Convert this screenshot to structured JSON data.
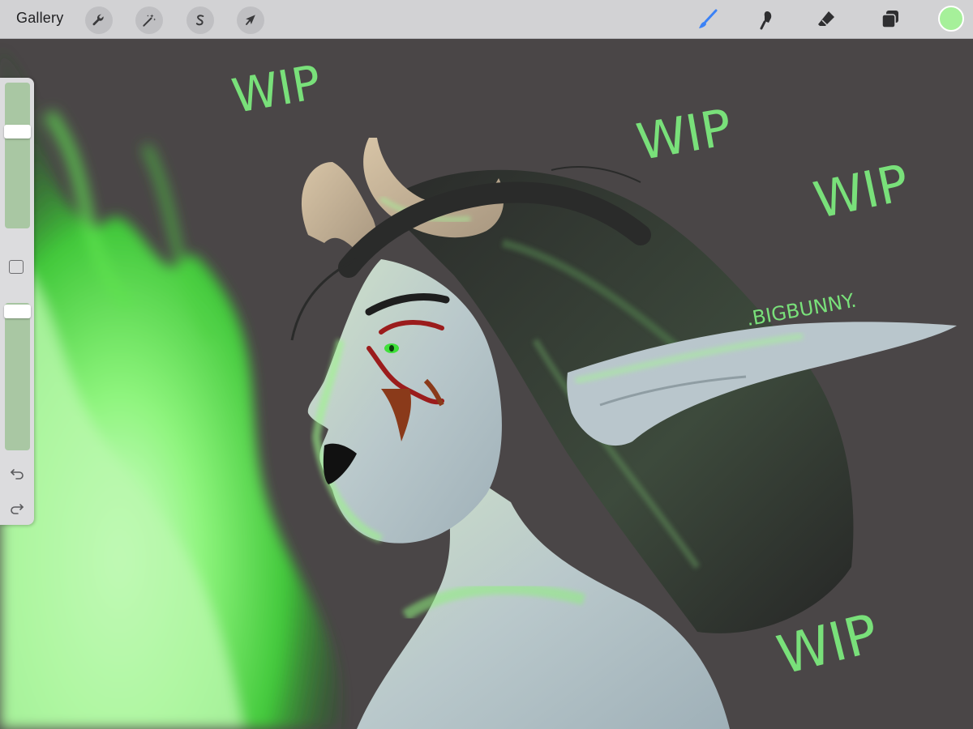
{
  "toolbar": {
    "gallery_label": "Gallery",
    "left_tools": [
      {
        "name": "actions-wrench-icon"
      },
      {
        "name": "adjustments-magic-wand-icon"
      },
      {
        "name": "selection-s-icon"
      },
      {
        "name": "transform-arrow-icon"
      }
    ],
    "right_tools": [
      {
        "name": "brush-icon",
        "active": true
      },
      {
        "name": "smudge-icon"
      },
      {
        "name": "eraser-icon"
      },
      {
        "name": "layers-icon"
      }
    ],
    "current_color": "#a6f09a",
    "active_color": "#3b82f6"
  },
  "sidebar": {
    "brush_size_level": 0.78,
    "opacity_level": 0.96,
    "modify_button": "square-icon",
    "undo_icon": "undo-icon",
    "redo_icon": "redo-icon"
  },
  "canvas": {
    "background_color": "#4a4647",
    "handwritten_notes": [
      "WIP",
      "WIP",
      "WIP",
      "WIP",
      ".BIGBUNNY."
    ],
    "note_color": "#79e07a"
  }
}
